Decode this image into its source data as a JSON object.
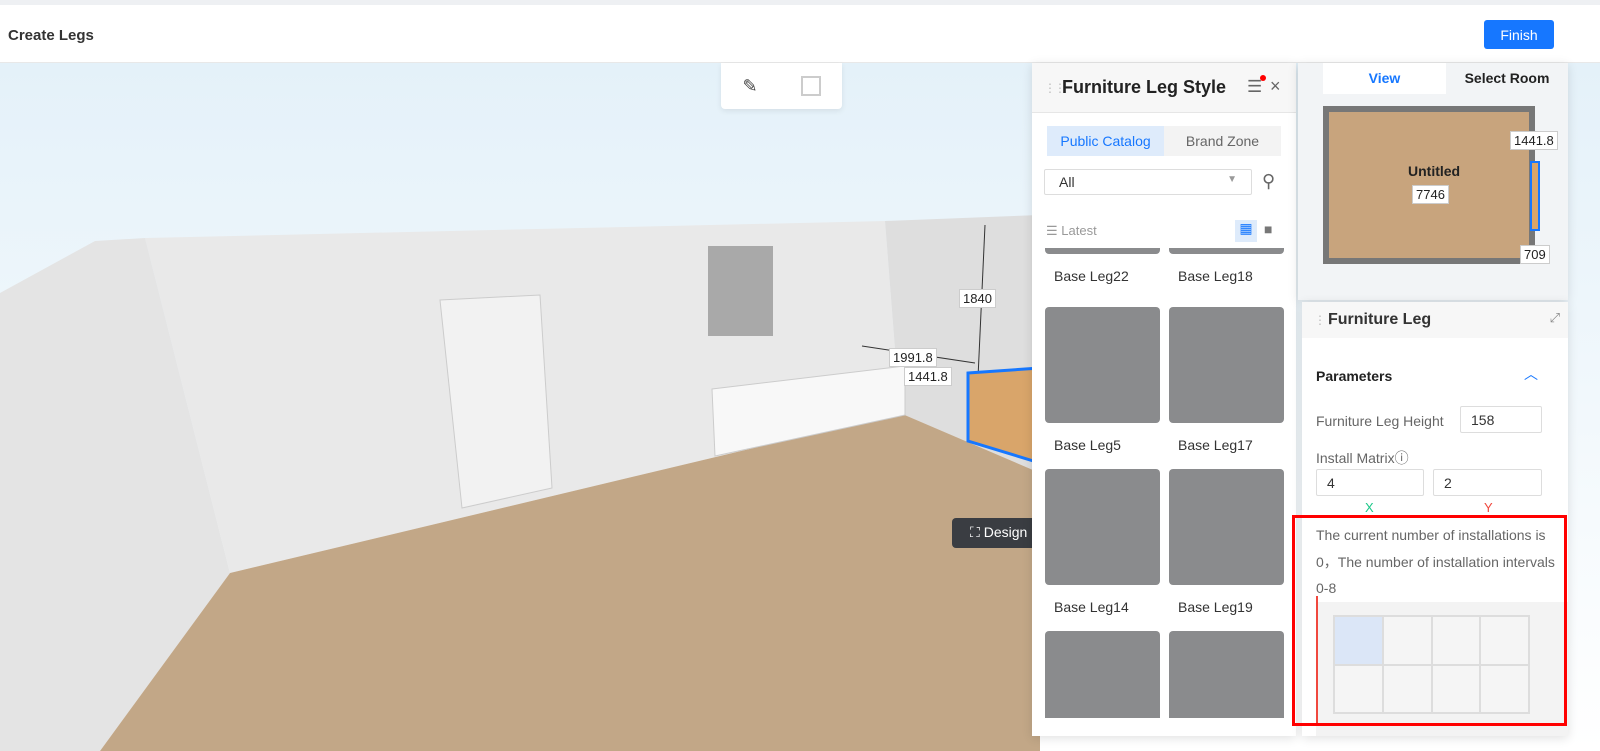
{
  "header": {
    "title": "Create Legs",
    "finish_label": "Finish"
  },
  "scene": {
    "dimensions": {
      "height": "1840",
      "depth_top": "1991.8",
      "depth_bottom": "1441.8"
    },
    "design_button": "Design"
  },
  "leg_style_panel": {
    "title": "Furniture Leg Style",
    "tabs": [
      "Public Catalog",
      "Brand Zone"
    ],
    "active_tab": 0,
    "filter_value": "All",
    "sort_label": "Latest",
    "items": [
      "Base Leg22",
      "Base Leg18",
      "Base Leg5",
      "Base Leg17",
      "Base Leg14",
      "Base Leg19"
    ]
  },
  "minimap": {
    "tabs": [
      "View",
      "Select Room"
    ],
    "active_tab": 0,
    "room_name": "Untitled",
    "dims": [
      "1441.8",
      "7746",
      "709"
    ]
  },
  "furniture_leg_panel": {
    "title": "Furniture Leg",
    "section": "Parameters",
    "height_label": "Furniture Leg Height",
    "height_value": "158",
    "matrix_label": "Install Matrix",
    "matrix_x": "4",
    "matrix_y": "2",
    "x_axis": "X",
    "y_axis": "Y",
    "info_text": "The current number of installations is 0，The number of installation intervals 0-8",
    "matrix_cols": 4,
    "matrix_rows": 2,
    "selected_cells": [
      [
        0,
        0
      ]
    ]
  },
  "colors": {
    "accent": "#1677ff",
    "highlight": "#ff0000"
  }
}
